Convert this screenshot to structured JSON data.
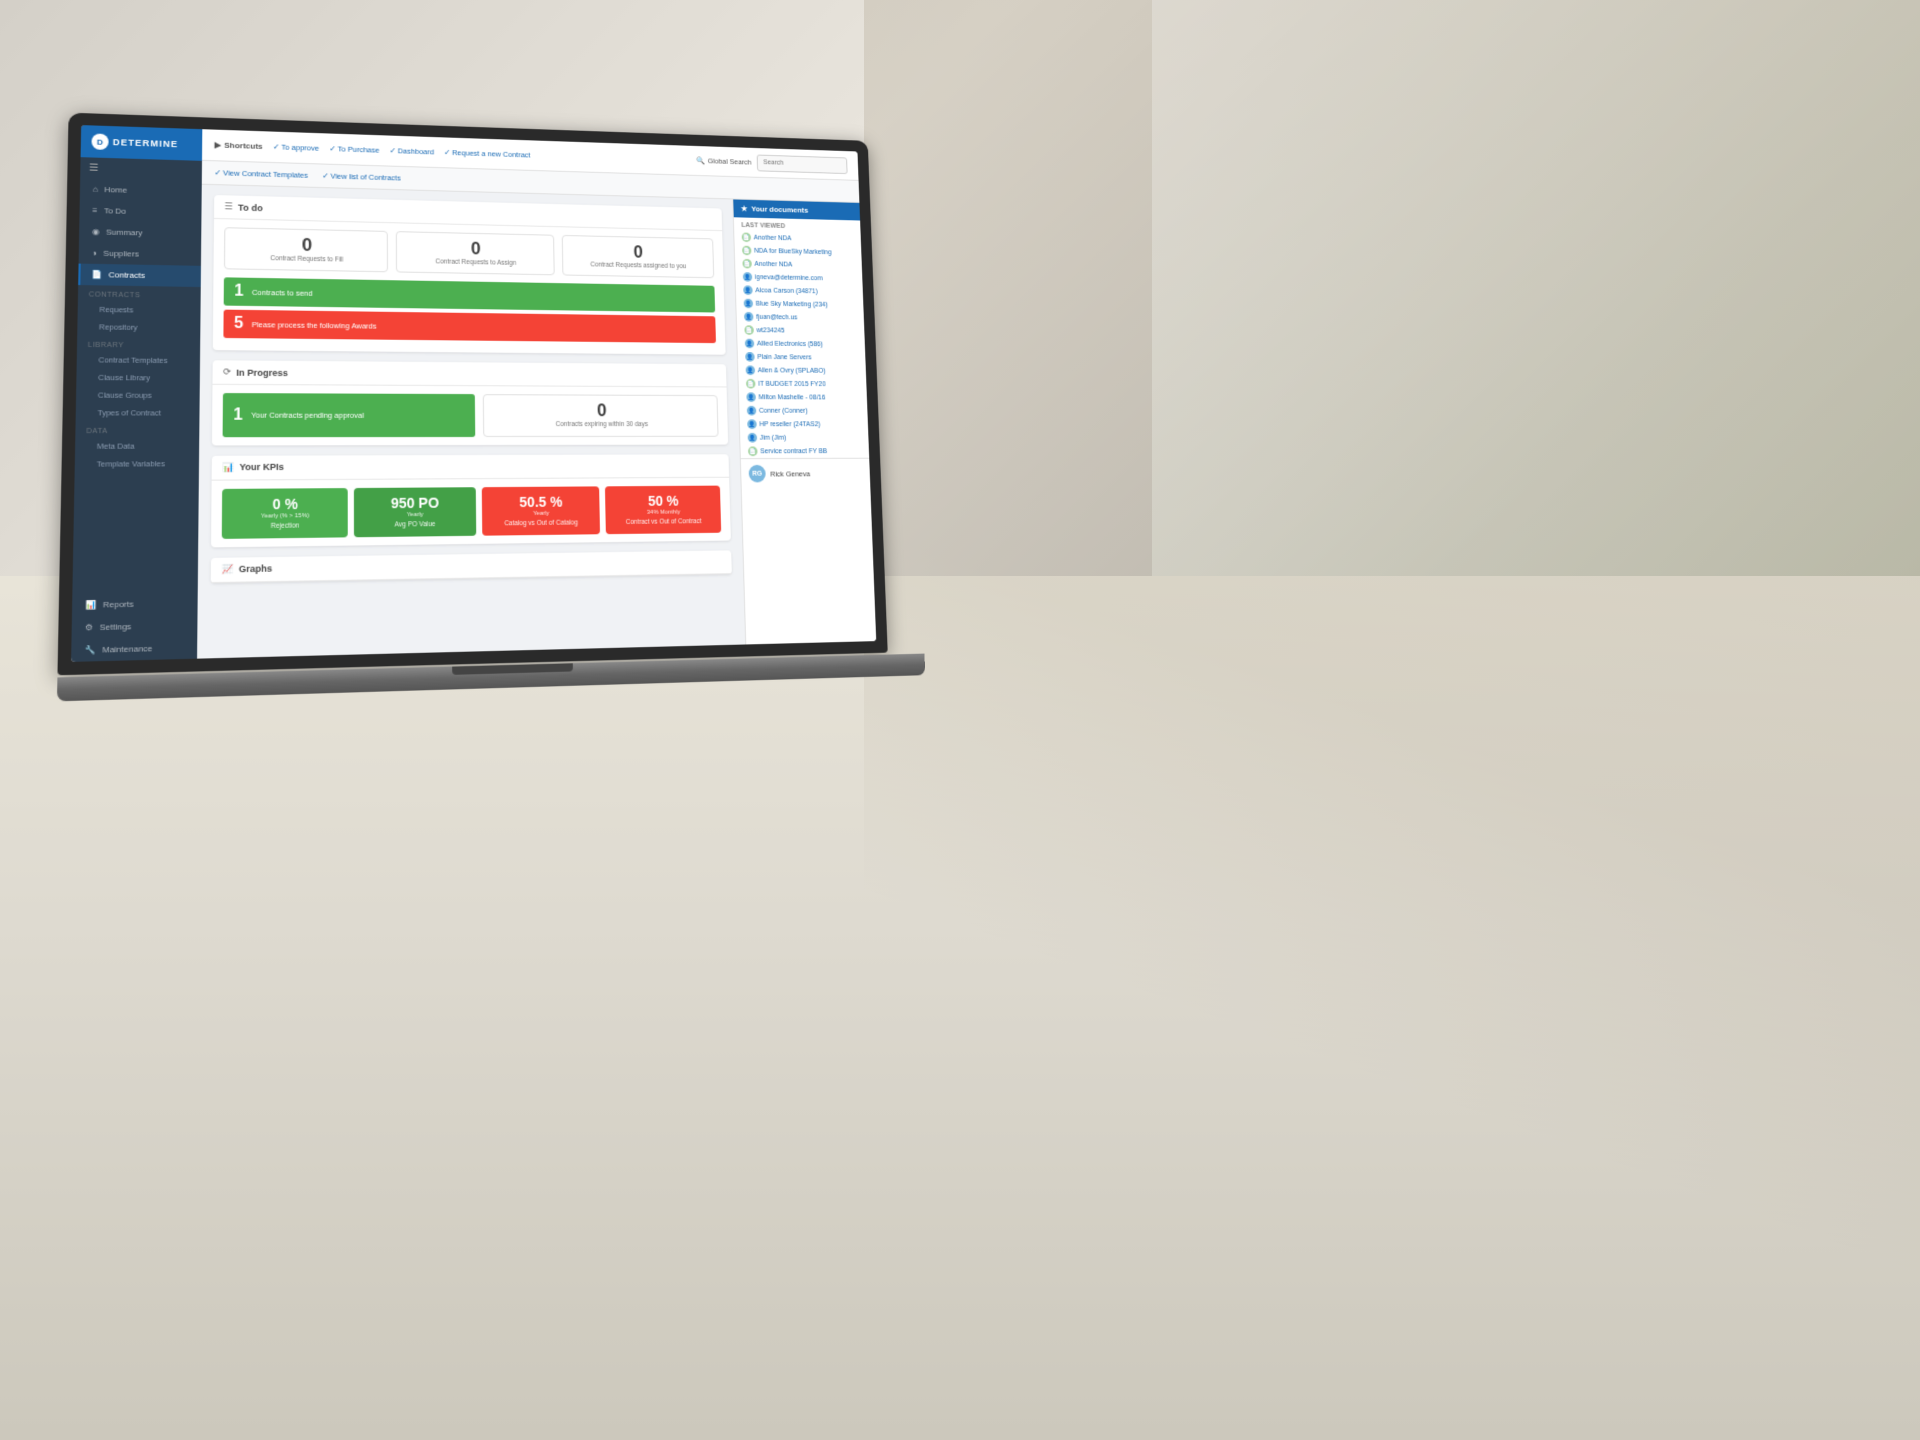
{
  "app": {
    "title": "DETERMINE",
    "logo_symbol": "D"
  },
  "topbar": {
    "shortcuts_label": "Shortcuts",
    "links": [
      {
        "label": "To approve",
        "icon": "✓"
      },
      {
        "label": "To Purchase",
        "icon": "✓"
      },
      {
        "label": "Dashboard",
        "icon": "✓"
      },
      {
        "label": "Request a new Contract",
        "icon": "✓"
      }
    ],
    "search_label": "Global Search",
    "search_placeholder": "Search"
  },
  "subnav": {
    "links": [
      {
        "label": "View Contract Templates",
        "icon": "✓"
      },
      {
        "label": "View list of Contracts",
        "icon": "✓"
      }
    ]
  },
  "sidebar": {
    "items": [
      {
        "label": "Home",
        "icon": "⌂",
        "active": false
      },
      {
        "label": "To Do",
        "icon": "≡",
        "active": false
      },
      {
        "label": "Summary",
        "icon": "◉",
        "active": false
      },
      {
        "label": "Suppliers",
        "icon": "◑",
        "active": false
      },
      {
        "label": "Contracts",
        "icon": "📄",
        "active": true
      }
    ],
    "contracts_section": "CONTRACTS",
    "contracts_sub": [
      "Requests",
      "Repository"
    ],
    "library_section": "LIBRARY",
    "library_sub": [
      "Contract Templates",
      "Clause Library",
      "Clause Groups",
      "Types of Contract"
    ],
    "data_section": "DATA",
    "data_sub": [
      "Meta Data",
      "Template Variables"
    ],
    "bottom_items": [
      {
        "label": "Reports",
        "icon": "📊"
      },
      {
        "label": "Settings",
        "icon": "⚙"
      },
      {
        "label": "Maintenance",
        "icon": "🔧"
      }
    ]
  },
  "todo_section": {
    "title": "To do",
    "icon": "☰",
    "counts": [
      {
        "number": "0",
        "label": "Contract Requests to Fill"
      },
      {
        "number": "0",
        "label": "Contract Requests to Assign"
      },
      {
        "number": "0",
        "label": "Contract Requests assigned to you"
      }
    ],
    "action_buttons": [
      {
        "count": "1",
        "label": "Contracts to send",
        "color": "green"
      },
      {
        "count": "5",
        "label": "Please process the following Awards",
        "color": "red"
      }
    ]
  },
  "in_progress_section": {
    "title": "In Progress",
    "icon": "⟳",
    "counts": [
      {
        "number": "1",
        "label": "Your Contracts pending approval"
      },
      {
        "number": "0",
        "label": "Contracts expiring within 30 days"
      }
    ]
  },
  "kpi_section": {
    "title": "Your KPIs",
    "icon": "📊",
    "cards": [
      {
        "value": "0 %",
        "sub": "Yearly (% > 15%)",
        "label": "Rejection",
        "color": "green"
      },
      {
        "value": "950 PO",
        "sub": "Yearly",
        "label": "Avg PO Value",
        "color": "green2"
      },
      {
        "value": "50.5 %",
        "sub": "Yearly",
        "label": "Catalog vs Out of Catalog",
        "color": "red"
      },
      {
        "value": "50 %",
        "sub": "34% Monthly",
        "label": "Contract vs Out of Contract",
        "color": "red"
      }
    ]
  },
  "graphs_section": {
    "title": "Graphs",
    "icon": "📈"
  },
  "right_panel": {
    "title": "Your documents",
    "last_viewed_label": "Last Viewed",
    "documents": [
      {
        "label": "Another NDA",
        "type": "doc"
      },
      {
        "label": "NDA for BlueSky Marketing",
        "type": "doc"
      },
      {
        "label": "Another NDA",
        "type": "doc"
      },
      {
        "label": "igneva@determine.com",
        "type": "person"
      },
      {
        "label": "Alcoa Carson (34871)",
        "type": "person"
      },
      {
        "label": "Blue Sky Marketing (234)",
        "type": "person"
      },
      {
        "label": "fjuan@tech.us",
        "type": "person"
      },
      {
        "label": "wt234245",
        "type": "doc"
      },
      {
        "label": "Allied Electronics (586)",
        "type": "person"
      },
      {
        "label": "Plain Jane Servers",
        "type": "person"
      },
      {
        "label": "Allen & Ovry (SPLABO)",
        "type": "person"
      },
      {
        "label": "IT BUDGET 2015 FY20",
        "type": "doc"
      },
      {
        "label": "Milton Mashelle - 08/16",
        "type": "person"
      },
      {
        "label": "Conner (Conner)",
        "type": "person"
      },
      {
        "label": "HP reseller (24TAS2)",
        "type": "person"
      },
      {
        "label": "Jim (Jim)",
        "type": "person"
      },
      {
        "label": "Service contract FY BB",
        "type": "doc"
      }
    ],
    "user": {
      "name": "Rick Geneva",
      "initials": "RG"
    }
  }
}
